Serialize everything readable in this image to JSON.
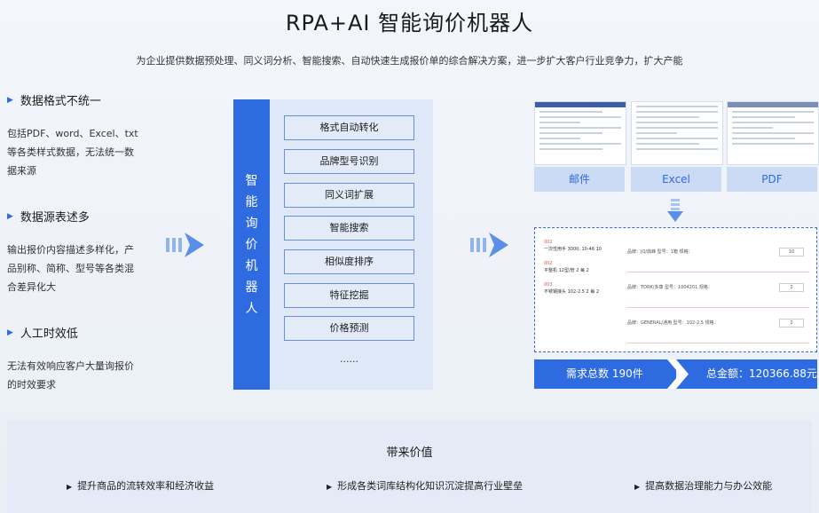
{
  "header": {
    "title": "RPA+AI 智能询价机器人",
    "subtitle": "为企业提供数据预处理、同义词分析、智能搜索、自动快速生成报价单的综合解决方案，进一步扩大客户行业竞争力，扩大产能"
  },
  "problems": [
    {
      "title": "数据格式不统一",
      "desc": "包括PDF、word、Excel、txt等各类样式数据，无法统一数据来源"
    },
    {
      "title": "数据源表述多",
      "desc": "输出报价内容描述多样化，产品别称、简称、型号等各类混合差异化大"
    },
    {
      "title": "人工时效低",
      "desc": "无法有效响应客户大量询报价的时效要求"
    }
  ],
  "robot": {
    "label_chars": [
      "智",
      "能",
      "询",
      "价",
      "机",
      "器",
      "人"
    ],
    "features": [
      "格式自动转化",
      "品牌型号识别",
      "同义词扩展",
      "智能搜索",
      "相似度排序",
      "特征挖掘",
      "价格预测"
    ],
    "more": "......"
  },
  "sources": {
    "tabs": [
      "邮件",
      "Excel",
      "PDF"
    ]
  },
  "result_preview": {
    "items": [
      {
        "no": "001",
        "text": "一次性用手 3000, 10-46 10"
      },
      {
        "no": "002",
        "text": "平整机 12型/管 2 每 2"
      },
      {
        "no": "003",
        "text": "不锈钢接头 102-2.5 2 每 2"
      }
    ],
    "rows": [
      {
        "text": "品牌：JQ/鼎峰   型号：1箱   规格：",
        "qty": "10"
      },
      {
        "text": "品牌：TORK/多康   型号：1004201   规格：",
        "qty": "2"
      },
      {
        "text": "品牌：GENERAL/通用   型号：102-2.5   规格：",
        "qty": "2"
      }
    ]
  },
  "summary": {
    "total_label": "需求总数 190件",
    "amount_label": "总金额：120366.88元"
  },
  "values": {
    "title": "带来价值",
    "items": [
      "提升商品的流转效率和经济收益",
      "形成各类词库结构化知识沉淀提高行业壁垒",
      "提高数据治理能力与办公效能"
    ]
  }
}
